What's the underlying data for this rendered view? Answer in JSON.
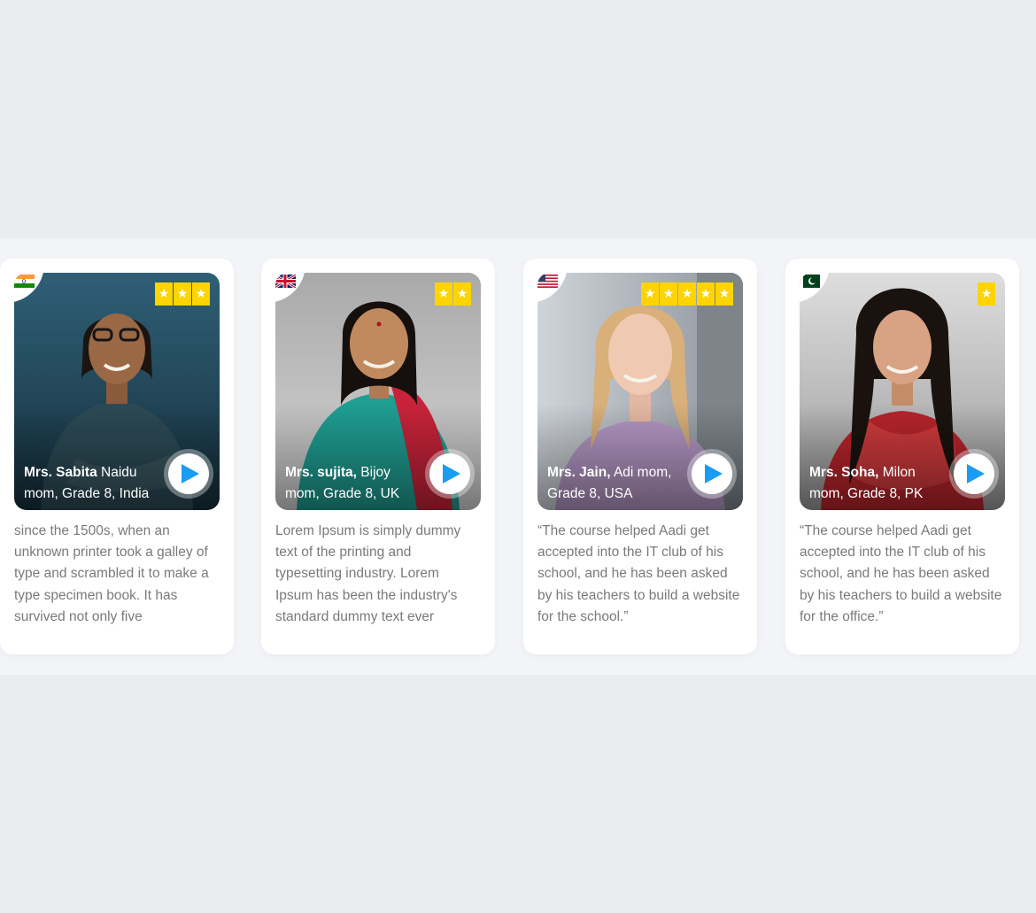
{
  "colors": {
    "page_bg": "#ebecf0",
    "band_bg": "#f2f4f8",
    "star": "#ffd400",
    "play": "#1a9cf3",
    "quote_text": "#7a7a7a"
  },
  "testimonials": [
    {
      "first": "Mrs. Sabita",
      "last": "Naidu",
      "detail": "mom, Grade 8, India",
      "flag_icon": "india-flag-icon",
      "rating": 3,
      "quote": "since the 1500s, when an unknown printer took a galley of type and scrambled it to make a type specimen book. It has survived not only five"
    },
    {
      "first": "Mrs. sujita,",
      "last": "Bijoy",
      "detail": "mom, Grade 8, UK",
      "flag_icon": "uk-flag-icon",
      "rating": 2,
      "quote": "Lorem Ipsum is simply dummy text of the printing and typesetting industry. Lorem Ipsum has been the industry's standard dummy text ever"
    },
    {
      "first": "Mrs. Jain,",
      "last": "Adi mom,",
      "detail": "Grade 8, USA",
      "flag_icon": "usa-flag-icon",
      "rating": 5,
      "quote": "“The course helped Aadi get accepted into the IT club of his school, and he has been asked by his teachers to build a website for the school.”"
    },
    {
      "first": "Mrs. Soha,",
      "last": "Milon",
      "detail": "mom, Grade 8, PK",
      "flag_icon": "pakistan-flag-icon",
      "rating": 1,
      "quote": "“The course helped Aadi get accepted into the IT club of his school, and he has been asked by his teachers to build a website for the office.”"
    }
  ]
}
